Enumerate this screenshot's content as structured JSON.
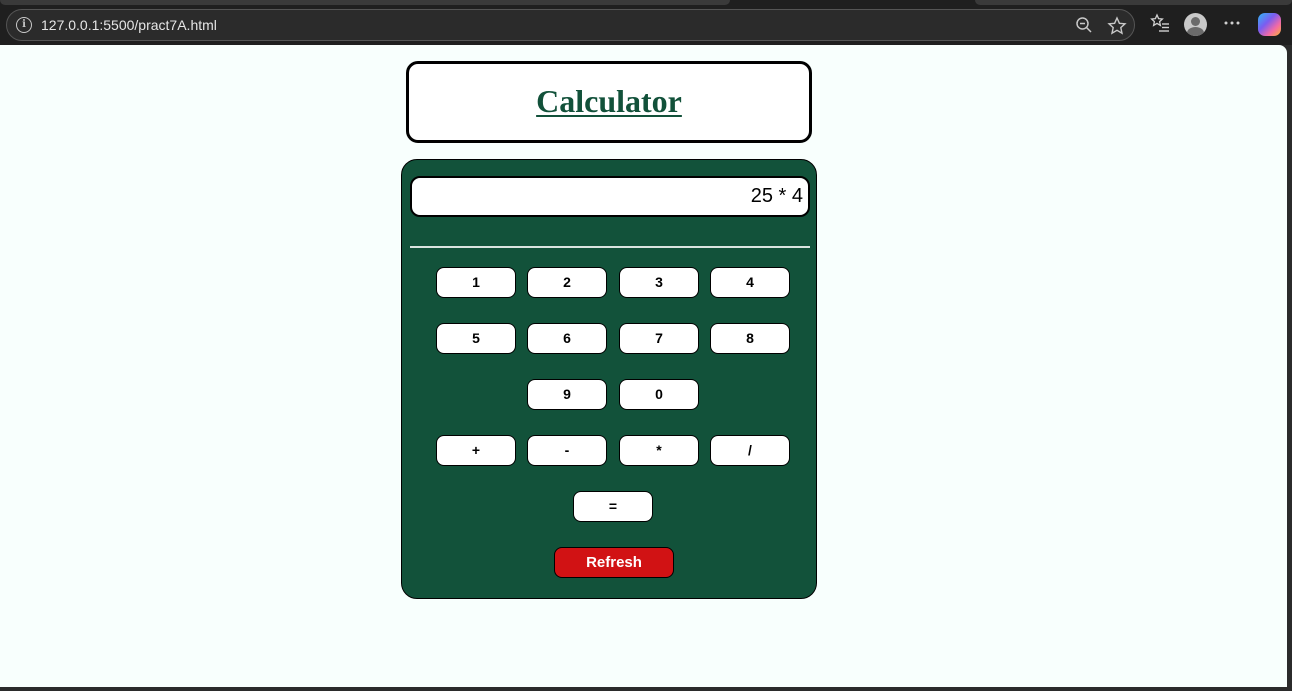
{
  "browser": {
    "url": "127.0.0.1:5500/pract7A.html",
    "icons": [
      "info-icon",
      "zoom-out-icon",
      "favorite-star-icon",
      "favorites-list-icon",
      "profile-avatar-icon",
      "more-menu-icon",
      "copilot-icon"
    ]
  },
  "page": {
    "title": "Calculator",
    "display_value": "25 * 4",
    "keys": {
      "row1": [
        "1",
        "2",
        "3",
        "4"
      ],
      "row2": [
        "5",
        "6",
        "7",
        "8"
      ],
      "row3": [
        "9",
        "0"
      ],
      "operators": [
        "+",
        "-",
        "*",
        "/"
      ],
      "equals": "="
    },
    "refresh_label": "Refresh",
    "colors": {
      "background": "#f8fffd",
      "panel": "#12523a",
      "title": "#12513a",
      "refresh": "#d11214"
    }
  }
}
